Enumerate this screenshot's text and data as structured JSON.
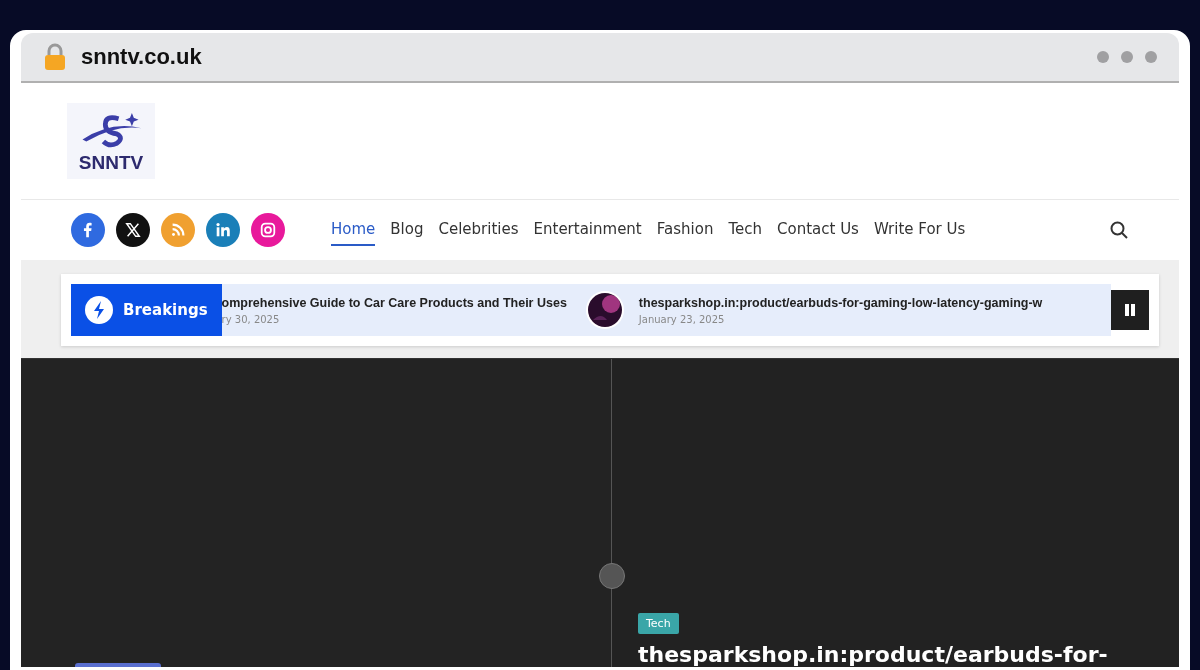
{
  "browser": {
    "address": "snntv.co.uk"
  },
  "logo": {
    "text": "SNNTV"
  },
  "social": [
    {
      "kind": "facebook"
    },
    {
      "kind": "x"
    },
    {
      "kind": "rss"
    },
    {
      "kind": "linkedin"
    },
    {
      "kind": "instagram"
    }
  ],
  "nav": [
    {
      "label": "Home",
      "selected": true
    },
    {
      "label": "Blog",
      "selected": false
    },
    {
      "label": "Celebrities",
      "selected": false
    },
    {
      "label": "Entertainment",
      "selected": false
    },
    {
      "label": "Fashion",
      "selected": false
    },
    {
      "label": "Tech",
      "selected": false
    },
    {
      "label": "Contact Us",
      "selected": false
    },
    {
      "label": "Write For Us",
      "selected": false
    }
  ],
  "ticker": {
    "label": "Breakings",
    "items": [
      {
        "title": "omprehensive Guide to Car Care Products and Their Uses",
        "date": "ry 30, 2025",
        "thumbnail": false
      },
      {
        "title": "thesparkshop.in:product/earbuds-for-gaming-low-latency-gaming-w",
        "date": "January 23, 2025",
        "thumbnail": true
      }
    ]
  },
  "hero": {
    "category": "Tech",
    "headline": "thesparkshop.in:product/earbuds-for-"
  }
}
